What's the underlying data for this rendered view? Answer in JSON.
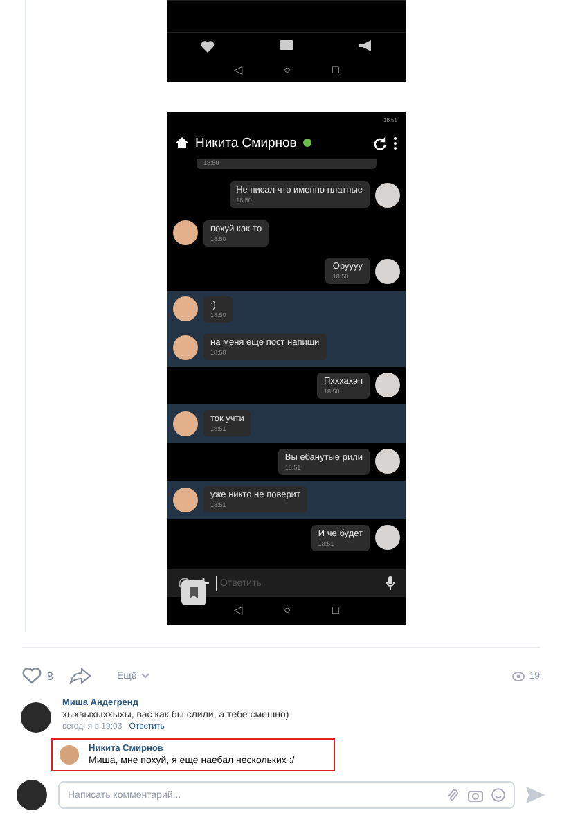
{
  "top_screenshot": {
    "nav_keys": [
      "◁",
      "○",
      "□"
    ]
  },
  "chat_screenshot": {
    "status_time": "18:51",
    "title": "Никита Смирнов",
    "online": true,
    "messages": [
      {
        "outgoing": true,
        "time": "18:50",
        "unread": false,
        "kind": "partial"
      },
      {
        "outgoing": true,
        "text": "Не писал что именно платные",
        "time": "18:50",
        "unread": false,
        "kind": "full"
      },
      {
        "outgoing": false,
        "text": "похуй как-то",
        "time": "18:50",
        "unread": false,
        "kind": "full"
      },
      {
        "outgoing": true,
        "text": "Оруууу",
        "time": "18:50",
        "unread": false,
        "kind": "full"
      },
      {
        "outgoing": false,
        "text": ":)",
        "time": "18:50",
        "unread": true,
        "kind": "full"
      },
      {
        "outgoing": false,
        "text": "на меня еще пост напиши",
        "time": "18:50",
        "unread": true,
        "kind": "full"
      },
      {
        "outgoing": true,
        "text": "Пхххахэп",
        "time": "18:50",
        "unread": false,
        "kind": "full"
      },
      {
        "outgoing": false,
        "text": "ток учти",
        "time": "18:51",
        "unread": true,
        "kind": "full"
      },
      {
        "outgoing": true,
        "text": "Вы ебанутые рили",
        "time": "18:51",
        "unread": false,
        "kind": "full"
      },
      {
        "outgoing": false,
        "text": "уже никто не поверит",
        "time": "18:51",
        "unread": true,
        "kind": "full"
      },
      {
        "outgoing": true,
        "text": "И че будет",
        "time": "18:51",
        "unread": false,
        "kind": "full"
      }
    ],
    "input_placeholder": "Ответить",
    "nav_keys": [
      "◁",
      "○",
      "□"
    ]
  },
  "actions": {
    "likes": "8",
    "more": "Ещё",
    "views": "19"
  },
  "comments": [
    {
      "author": "Миша Андегренд",
      "text": "хыхвыхыххыхы, вас как бы слили, а тебе смешно)",
      "date": "сегодня в 19:03",
      "reply": "Ответить"
    }
  ],
  "replies": [
    {
      "author": "Никита Смирнов",
      "text": "Миша, мне похуй, я еще наебал нескольких :/",
      "highlighted": true
    }
  ],
  "comment_field": {
    "placeholder": "Написать комментарий..."
  }
}
